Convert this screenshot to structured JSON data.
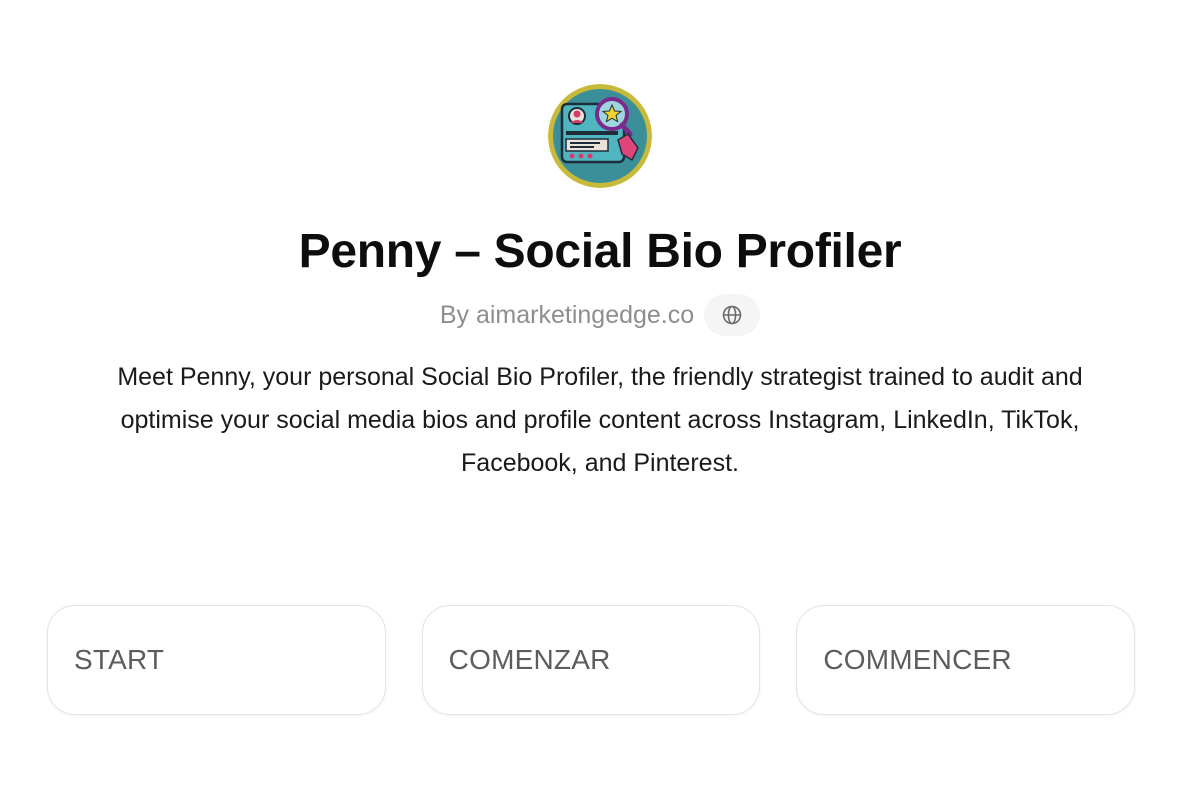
{
  "gpt": {
    "avatar_icon": "profile-magnifier-icon",
    "title": "Penny – Social Bio Profiler",
    "byline": "By aimarketingedge.co",
    "website_icon": "globe-icon",
    "description": "Meet Penny, your personal Social Bio Profiler, the friendly strategist trained to audit and optimise your social media bios and profile content across Instagram, LinkedIn, TikTok, Facebook, and Pinterest."
  },
  "conversation_starters": [
    {
      "label": "START"
    },
    {
      "label": "COMENZAR"
    },
    {
      "label": "COMMENCER"
    }
  ],
  "colors": {
    "title": "#0d0d0d",
    "byline": "#8e8e8e",
    "starter_border": "#e3e3e3",
    "starter_text": "#5d5d5d"
  }
}
